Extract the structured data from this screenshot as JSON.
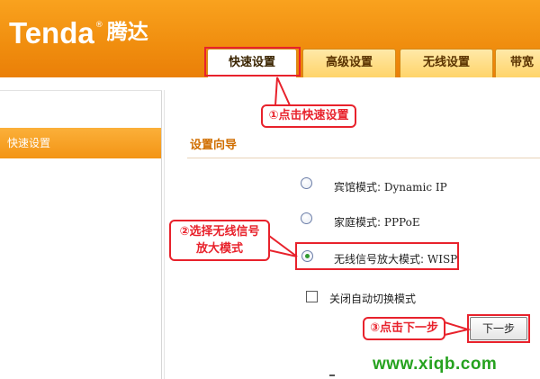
{
  "brand": {
    "logo_en": "Tenda",
    "logo_reg": "®",
    "logo_cn": "腾达"
  },
  "tabs": [
    {
      "label": "快速设置",
      "active": true
    },
    {
      "label": "高级设置",
      "active": false
    },
    {
      "label": "无线设置",
      "active": false
    },
    {
      "label": "带宽",
      "active": false
    }
  ],
  "sidebar": {
    "items": [
      {
        "label": "快速设置",
        "selected": true
      }
    ]
  },
  "wizard": {
    "title": "设置向导",
    "options": [
      {
        "label_cn": "宾馆模式:",
        "label_en": "Dynamic IP",
        "checked": false
      },
      {
        "label_cn": "家庭模式:",
        "label_en": "PPPoE",
        "checked": false
      },
      {
        "label_cn": "无线信号放大模式:",
        "label_en": "WISP",
        "checked": true
      }
    ],
    "auto_switch_label": "关闭自动切换模式",
    "auto_switch_checked": false,
    "next_label": "下一步"
  },
  "annotations": {
    "step1": "①点击快速设置",
    "step2_line1": "②选择无线信号",
    "step2_line2": "放大模式",
    "step3": "③点击下一步"
  },
  "watermark": "www.xiqb.com",
  "colors": {
    "header_orange": "#f08d0e",
    "annotation_red": "#e8222c",
    "title_orange": "#d06e00",
    "watermark_green": "#26a21f"
  },
  "icons": {
    "radio": "radio-button",
    "checkbox": "checkbox"
  }
}
